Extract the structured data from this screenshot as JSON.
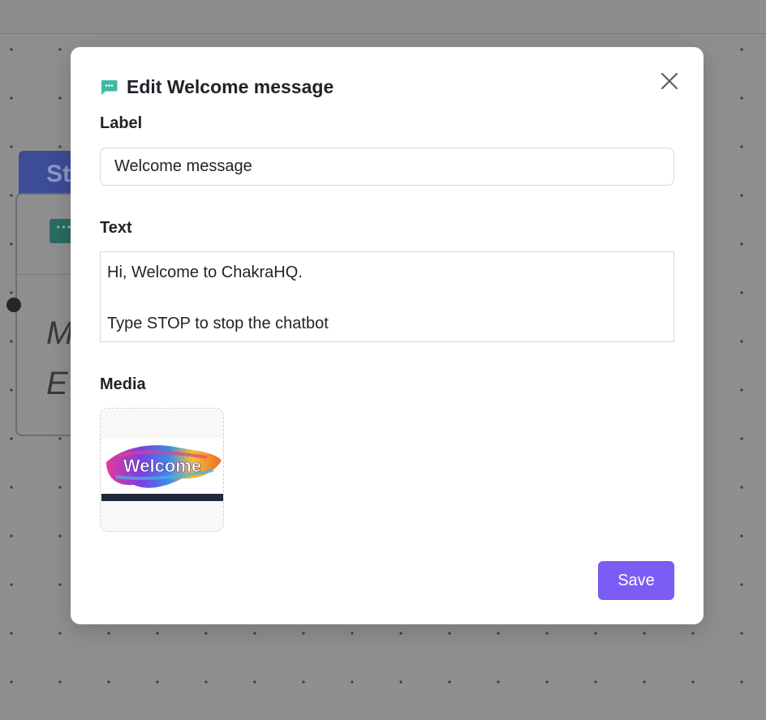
{
  "background": {
    "node_header_fragment": "St",
    "node_text_fragment_line1": "M",
    "node_text_fragment_line2": "E",
    "node_icon": "chat-bubble-icon"
  },
  "modal": {
    "title": "Edit Welcome message",
    "title_icon": "chat-bubble-icon",
    "close_icon": "close-icon",
    "label_field": {
      "label": "Label",
      "value": "Welcome message"
    },
    "text_field": {
      "label": "Text",
      "line1": "Hi, Welcome to ChakraHQ.",
      "line2": "",
      "line3": "Type STOP to stop the chatbot"
    },
    "media_field": {
      "label": "Media",
      "image_text": "Welcome"
    },
    "save_label": "Save"
  },
  "colors": {
    "accent": "#7b5cf5",
    "icon_teal": "#3fb8a4",
    "overlay": "#8f8f8f"
  }
}
